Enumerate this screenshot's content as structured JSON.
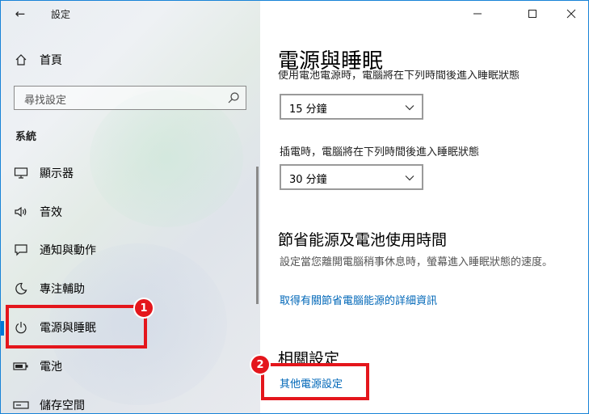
{
  "window": {
    "app_title": "設定",
    "back_glyph": "←",
    "controls": {
      "minimize": "minimize-icon",
      "maximize": "maximize-icon",
      "close": "close-icon"
    }
  },
  "sidebar": {
    "home_label": "首頁",
    "search_placeholder": "尋找設定",
    "section_label": "系統",
    "items": [
      {
        "label": "顯示器",
        "icon": "monitor-icon"
      },
      {
        "label": "音效",
        "icon": "speaker-icon"
      },
      {
        "label": "通知與動作",
        "icon": "notification-icon"
      },
      {
        "label": "專注輔助",
        "icon": "moon-icon"
      },
      {
        "label": "電源與睡眠",
        "icon": "power-icon",
        "selected": true
      },
      {
        "label": "電池",
        "icon": "battery-icon"
      },
      {
        "label": "儲存空間",
        "icon": "storage-icon"
      }
    ]
  },
  "main": {
    "title": "電源與睡眠",
    "cut_label": "使用電池電源時，電腦將在下列時間後進入睡眠狀態",
    "battery_sleep_value": "15 分鐘",
    "plugged_label": "插電時，電腦將在下列時間後進入睡眠狀態",
    "plugged_sleep_value": "30 分鐘",
    "saving_heading": "節省能源及電池使用時間",
    "saving_desc": "設定當您離開電腦稍事休息時，螢幕進入睡眠狀態的速度。",
    "saving_link": "取得有關節省電腦能源的詳細資訊",
    "related_heading": "相關設定",
    "related_link": "其他電源設定"
  },
  "annotations": {
    "badge1": "1",
    "badge2": "2",
    "color": "#e4161c"
  },
  "colors": {
    "accent": "#0078d7",
    "link": "#0067b8"
  }
}
